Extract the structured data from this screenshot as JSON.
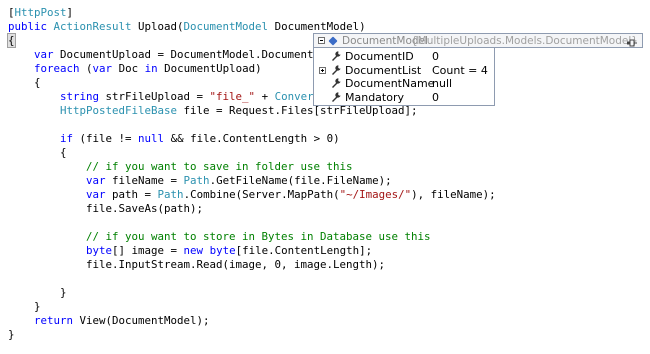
{
  "code": {
    "lines": [
      [
        {
          "t": "[",
          "c": "tx"
        },
        {
          "t": "HttpPost",
          "c": "ty"
        },
        {
          "t": "]",
          "c": "tx"
        }
      ],
      [
        {
          "t": "public ",
          "c": "kw"
        },
        {
          "t": "ActionResult",
          "c": "ty"
        },
        {
          "t": " Upload(",
          "c": "tx"
        },
        {
          "t": "DocumentModel",
          "c": "ty"
        },
        {
          "t": " DocumentModel)",
          "c": "tx"
        }
      ],
      [
        {
          "t": "{",
          "c": "tx",
          "h": true
        }
      ],
      [
        {
          "t": "    ",
          "c": "tx"
        },
        {
          "t": "var",
          "c": "kw"
        },
        {
          "t": " DocumentUpload = DocumentModel.DocumentLi",
          "c": "tx"
        }
      ],
      [
        {
          "t": "    ",
          "c": "tx"
        },
        {
          "t": "foreach",
          "c": "kw"
        },
        {
          "t": " (",
          "c": "tx"
        },
        {
          "t": "var",
          "c": "kw"
        },
        {
          "t": " Doc ",
          "c": "tx"
        },
        {
          "t": "in",
          "c": "kw"
        },
        {
          "t": " DocumentUpload)",
          "c": "tx"
        }
      ],
      [
        {
          "t": "    {",
          "c": "tx"
        }
      ],
      [
        {
          "t": "        ",
          "c": "tx"
        },
        {
          "t": "string",
          "c": "kw"
        },
        {
          "t": " strFileUpload = ",
          "c": "tx"
        },
        {
          "t": "\"file_\"",
          "c": "st"
        },
        {
          "t": " + ",
          "c": "tx"
        },
        {
          "t": "Convert",
          "c": "ty"
        },
        {
          "t": ".",
          "c": "tx"
        }
      ],
      [
        {
          "t": "        ",
          "c": "tx"
        },
        {
          "t": "HttpPostedFileBase",
          "c": "ty"
        },
        {
          "t": " file = Request.Files[strFileUpload];",
          "c": "tx"
        }
      ],
      [
        {
          "t": "",
          "c": "tx"
        }
      ],
      [
        {
          "t": "        ",
          "c": "tx"
        },
        {
          "t": "if",
          "c": "kw"
        },
        {
          "t": " (file != ",
          "c": "tx"
        },
        {
          "t": "null",
          "c": "kw"
        },
        {
          "t": " && file.ContentLength > 0)",
          "c": "tx"
        }
      ],
      [
        {
          "t": "        {",
          "c": "tx"
        }
      ],
      [
        {
          "t": "            ",
          "c": "tx"
        },
        {
          "t": "// if you want to save in folder use this",
          "c": "cm"
        }
      ],
      [
        {
          "t": "            ",
          "c": "tx"
        },
        {
          "t": "var",
          "c": "kw"
        },
        {
          "t": " fileName = ",
          "c": "tx"
        },
        {
          "t": "Path",
          "c": "ty"
        },
        {
          "t": ".GetFileName(file.FileName);",
          "c": "tx"
        }
      ],
      [
        {
          "t": "            ",
          "c": "tx"
        },
        {
          "t": "var",
          "c": "kw"
        },
        {
          "t": " path = ",
          "c": "tx"
        },
        {
          "t": "Path",
          "c": "ty"
        },
        {
          "t": ".Combine(Server.MapPath(",
          "c": "tx"
        },
        {
          "t": "\"~/Images/\"",
          "c": "st"
        },
        {
          "t": "), fileName);",
          "c": "tx"
        }
      ],
      [
        {
          "t": "            file.SaveAs(path);",
          "c": "tx"
        }
      ],
      [
        {
          "t": "",
          "c": "tx"
        }
      ],
      [
        {
          "t": "            ",
          "c": "tx"
        },
        {
          "t": "// if you want to store in Bytes in Database use this",
          "c": "cm"
        }
      ],
      [
        {
          "t": "            ",
          "c": "tx"
        },
        {
          "t": "byte",
          "c": "kw"
        },
        {
          "t": "[] image = ",
          "c": "tx"
        },
        {
          "t": "new",
          "c": "kw"
        },
        {
          "t": " ",
          "c": "tx"
        },
        {
          "t": "byte",
          "c": "kw"
        },
        {
          "t": "[file.ContentLength];",
          "c": "tx"
        }
      ],
      [
        {
          "t": "            file.InputStream.Read(image, 0, image.Length);",
          "c": "tx"
        }
      ],
      [
        {
          "t": "",
          "c": "tx"
        }
      ],
      [
        {
          "t": "        }",
          "c": "tx"
        }
      ],
      [
        {
          "t": "    }",
          "c": "tx"
        }
      ],
      [
        {
          "t": "    ",
          "c": "tx"
        },
        {
          "t": "return",
          "c": "kw"
        },
        {
          "t": " View(DocumentModel);",
          "c": "tx"
        }
      ],
      [
        {
          "t": "}",
          "c": "tx"
        }
      ]
    ]
  },
  "datatip": {
    "header": {
      "name": "DocumentModel",
      "value": "{MultipleUploads.Models.DocumentModel}",
      "icon": "object-icon",
      "pin_icon": "pin-icon"
    },
    "rows": [
      {
        "name": "DocumentID",
        "value": "0",
        "expandable": false
      },
      {
        "name": "DocumentList",
        "value": "Count = 4",
        "expandable": true
      },
      {
        "name": "DocumentName",
        "value": "null",
        "expandable": false
      },
      {
        "name": "Mandatory",
        "value": "0",
        "expandable": false
      }
    ],
    "property_icon": "wrench-icon"
  },
  "colors": {
    "keyword": "#0000ff",
    "type": "#2b91af",
    "string": "#a31515",
    "comment": "#008000",
    "text": "#000000",
    "datatip_border": "#8e9bb0"
  }
}
